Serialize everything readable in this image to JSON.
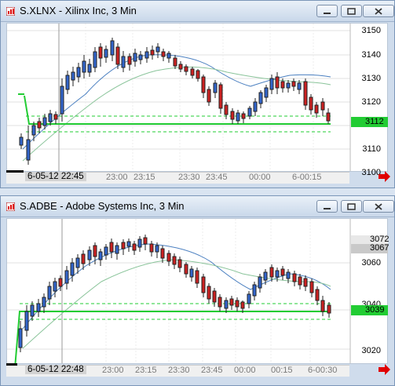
{
  "windows": [
    {
      "title": "S.XLNX - Xilinx Inc, 3 Min",
      "date_label": "6-05-12  22:45",
      "x_ticks": [
        "23:00",
        "23:15",
        "23:30",
        "23:45",
        "00:00",
        "6-00:15"
      ],
      "y_ticks": [
        "3150",
        "3140",
        "3130",
        "3120",
        "3110",
        "3100"
      ],
      "price_badge": "3112",
      "accent_green": "#22cc33",
      "up_color": "#3366cc",
      "down_color": "#cc2222"
    },
    {
      "title": "S.ADBE - Adobe Systems Inc, 3 Min",
      "date_label": "6-05-12  22:48",
      "x_ticks": [
        "23:00",
        "23:15",
        "23:30",
        "23:45",
        "00:00",
        "00:15",
        "6-00:30"
      ],
      "y_ticks": [
        "3060",
        "3040",
        "3020"
      ],
      "price_badges": [
        "3072",
        "3067"
      ],
      "price_badge": "3039",
      "accent_green": "#22cc33"
    }
  ],
  "icons": {
    "window_icon": "chart-app-icon",
    "minimize": "minimize-icon",
    "maximize": "maximize-icon",
    "close": "close-icon",
    "scroll": "right-arrow-icon"
  }
}
